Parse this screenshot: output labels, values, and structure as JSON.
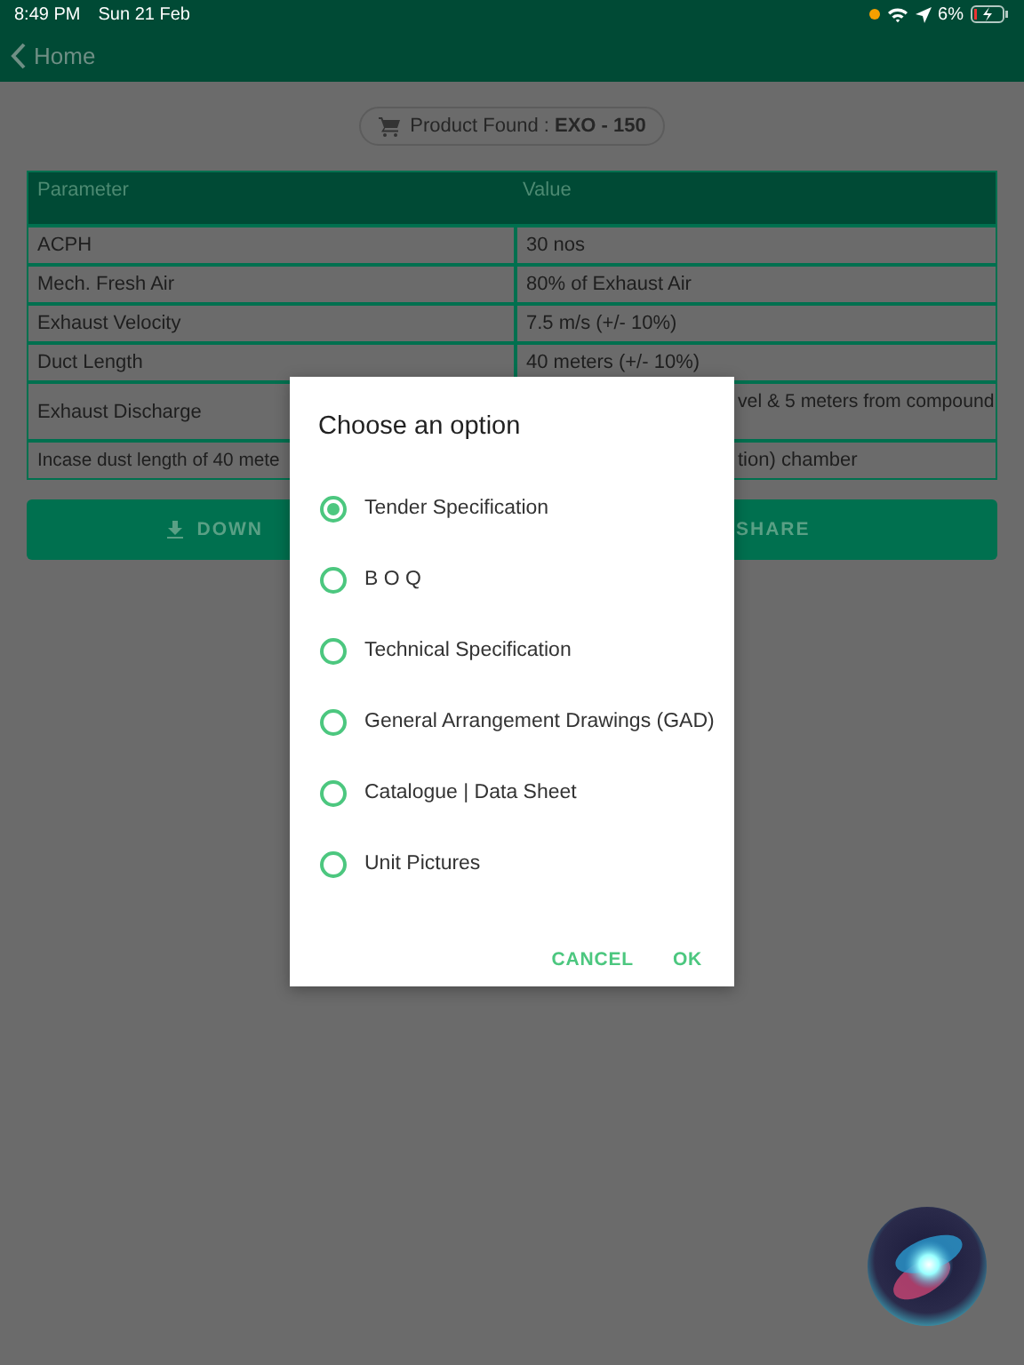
{
  "status_bar": {
    "time": "8:49 PM",
    "date": "Sun 21 Feb",
    "battery": "6%"
  },
  "nav": {
    "back": "Home"
  },
  "product": {
    "label": "Product Found : **EXO - 150**"
  },
  "table": {
    "columns": [
      "Parameter",
      "Value"
    ],
    "rows": [
      {
        "kind": "full",
        "cells": [
          "ACPH",
          "30 nos"
        ]
      },
      {
        "kind": "full",
        "cells": [
          "Mech. Fresh Air",
          "80% of Exhaust Air"
        ]
      },
      {
        "kind": "full",
        "cells": [
          "Exhaust Velocity",
          "7.5 m/s (+/- 10%)"
        ]
      },
      {
        "kind": "full",
        "cells": [
          "Duct Length",
          "40 meters (+/- 10%)"
        ]
      },
      {
        "kind": "covered-tall",
        "cells": [
          "Exhaust Discharge",
          "vel & 5 meters from compound"
        ]
      },
      {
        "kind": "covered",
        "cells": [
          "Incase dust length of 40 mete",
          "tion) chamber"
        ]
      }
    ]
  },
  "actions": [
    {
      "kind": "download",
      "label": "DOWN"
    },
    {
      "kind": "share",
      "label": "SHARE"
    }
  ],
  "dialog": {
    "title": "Choose an option",
    "options": [
      {
        "label": "Tender Specification",
        "selected": true
      },
      {
        "label": "B O Q",
        "selected": false
      },
      {
        "label": "Technical Specification",
        "selected": false
      },
      {
        "label": "General Arrangement Drawings (GAD)",
        "selected": false
      },
      {
        "label": "Catalogue | Data Sheet",
        "selected": false
      },
      {
        "label": "Unit Pictures",
        "selected": false
      }
    ],
    "buttons": [
      "CANCEL",
      "OK"
    ]
  }
}
